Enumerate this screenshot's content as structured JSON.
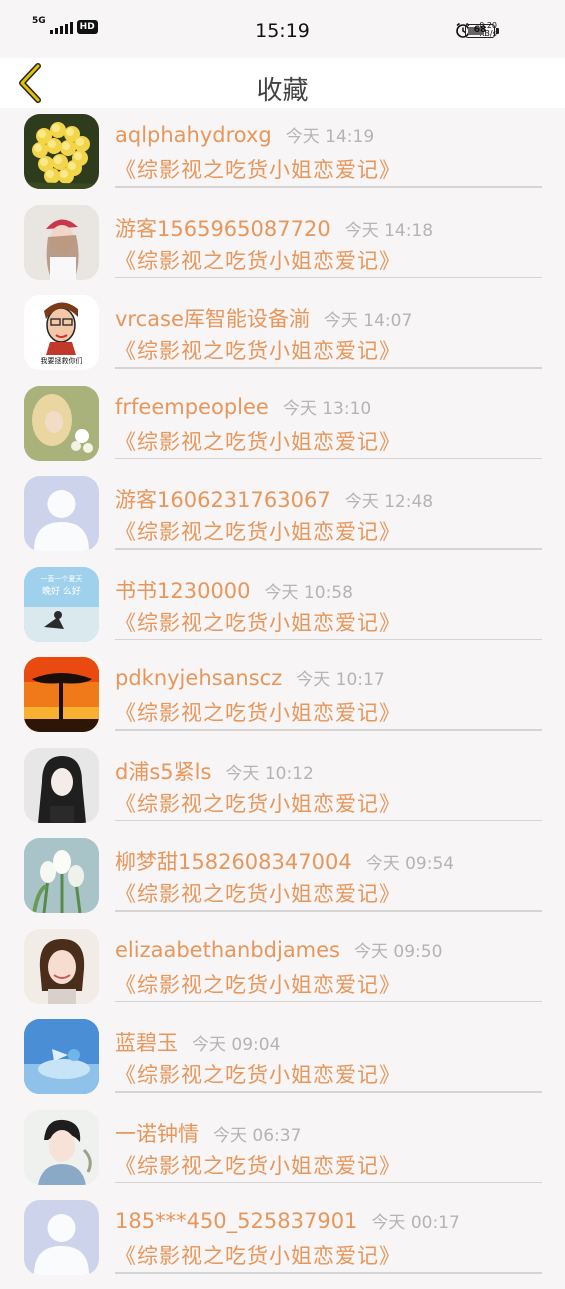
{
  "status_bar": {
    "network": "5G",
    "hd": "HD",
    "time": "15:19",
    "speed_value": "0.20",
    "speed_unit": "KB/s",
    "battery_level": "68"
  },
  "header": {
    "title": "收藏",
    "back_icon": "chevron-left-icon"
  },
  "colors": {
    "accent": "#e8965a",
    "time_text": "#b4b4b4",
    "back_icon": "#e0c200"
  },
  "items": [
    {
      "name": "aqlphahydroxg",
      "time": "今天 14:19",
      "title": "《综影视之吃货小姐恋爱记》",
      "avatar": "yellow-flower"
    },
    {
      "name": "游客1565965087720",
      "time": "今天 14:18",
      "title": "《综影视之吃货小姐恋爱记》",
      "avatar": "girl-red-hat"
    },
    {
      "name": "vrcase厍智能设备湔",
      "time": "今天 14:07",
      "title": "《综影视之吃货小姐恋爱记》",
      "avatar": "cartoon-face",
      "avatar_caption": "我要拯救你们"
    },
    {
      "name": "frfeempeoplee",
      "time": "今天 13:10",
      "title": "《综影视之吃货小姐恋爱记》",
      "avatar": "blonde-girl-flowers"
    },
    {
      "name": "游客1606231763067",
      "time": "今天 12:48",
      "title": "《综影视之吃货小姐恋爱记》",
      "avatar": "default-user"
    },
    {
      "name": "书书1230000",
      "time": "今天 10:58",
      "title": "《综影视之吃货小姐恋爱记》",
      "avatar": "beach-text",
      "avatar_caption": "一直一个夏天 晚好 么好"
    },
    {
      "name": "pdknyjehsanscz",
      "time": "今天 10:17",
      "title": "《综影视之吃货小姐恋爱记》",
      "avatar": "sunset-tree"
    },
    {
      "name": "d浦s5紧ls",
      "time": "今天 10:12",
      "title": "《综影视之吃货小姐恋爱记》",
      "avatar": "dark-hair-girl"
    },
    {
      "name": "柳梦甜1582608347004",
      "time": "今天 09:54",
      "title": "《综影视之吃货小姐恋爱记》",
      "avatar": "white-tulips"
    },
    {
      "name": "elizaabethanbdjames",
      "time": "今天 09:50",
      "title": "《综影视之吃货小姐恋爱记》",
      "avatar": "short-hair-girl"
    },
    {
      "name": "蓝碧玉",
      "time": "今天 09:04",
      "title": "《综影视之吃货小姐恋爱记》",
      "avatar": "blue-sky-bird"
    },
    {
      "name": "一诺钟情",
      "time": "今天 06:37",
      "title": "《综影视之吃货小姐恋爱记》",
      "avatar": "young-man"
    },
    {
      "name": "185***450_525837901",
      "time": "今天 00:17",
      "title": "《综影视之吃货小姐恋爱记》",
      "avatar": "default-user"
    }
  ]
}
